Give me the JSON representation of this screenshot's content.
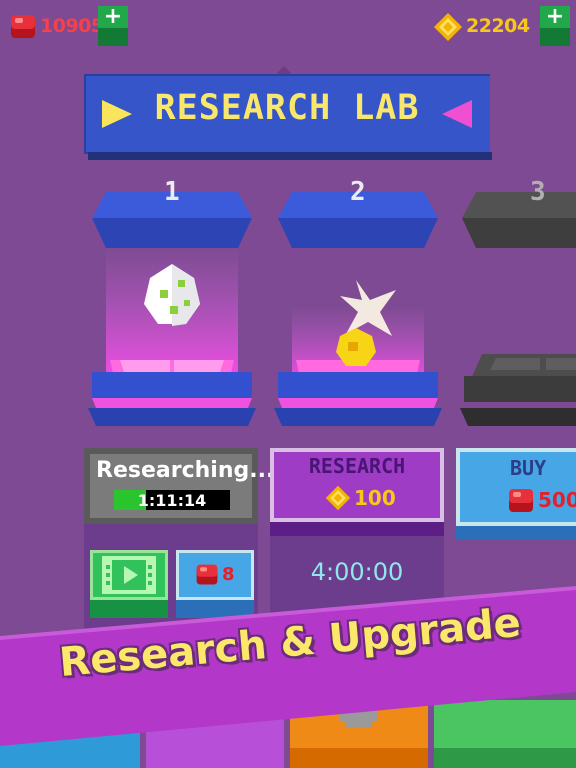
{
  "hud": {
    "gems": "10905",
    "coins": "22204",
    "add_gems_symbol": "+",
    "add_coins_symbol": "+"
  },
  "title": {
    "text": "RESEARCH LAB"
  },
  "slots": [
    {
      "number": "1",
      "status": "Researching...",
      "timer": "1:11:14",
      "progress": 0.28,
      "video_label": "",
      "gem_cost": "8"
    },
    {
      "number": "2",
      "action_label": "RESEARCH",
      "coin_cost": "100",
      "duration": "4:00:00"
    },
    {
      "number": "3",
      "action_label": "BUY",
      "gem_cost": "500"
    }
  ],
  "banner": {
    "text": "Research & Upgrade"
  },
  "colors": {
    "background": "#7e4a93",
    "pedestal_blue": "#3a5bd4",
    "glow_pink": "#e44ddf",
    "gold": "#f5c719",
    "gem_red": "#e1222c",
    "banner": "#b434c7",
    "banner_text": "#fbe86a"
  }
}
